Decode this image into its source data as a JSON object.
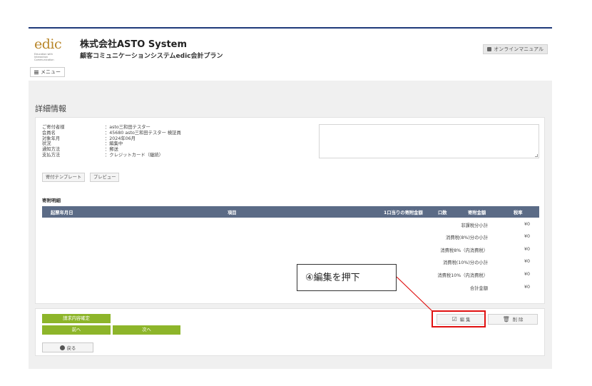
{
  "header": {
    "logo_word": "edic",
    "logo_tagline": "Education with Interaction Communication",
    "company": "株式会社ASTO System",
    "plan": "顧客コミュニケーションシステムedic会計プラン",
    "manual_label": "オンラインマニュアル",
    "menu_label": "メニュー"
  },
  "page": {
    "title": "詳細情報"
  },
  "info": {
    "rows": [
      {
        "label": "ご寄付者様",
        "value": "：asto三和田テスター"
      },
      {
        "label": "会員名",
        "value": "：45680 asto三和田テスター 検証員"
      },
      {
        "label": "対象年月",
        "value": "：2024年06月"
      },
      {
        "label": "状況",
        "value": "：編集中"
      },
      {
        "label": "通知方法",
        "value": "：郵送"
      },
      {
        "label": "支払方法",
        "value": "：クレジットカード（継続）"
      }
    ]
  },
  "buttons": {
    "template": "寄付テンプレート",
    "preview": "プレビュー",
    "confirm": "請求内容確定",
    "prev": "前へ",
    "next": "次へ",
    "back": "戻る",
    "edit": "編 集",
    "delete": "削 除"
  },
  "details": {
    "section_label": "寄附明細",
    "columns": [
      "起票年月日",
      "項目",
      "1口当りの寄附金額",
      "口数",
      "寄附金額",
      "税率"
    ],
    "summary": [
      {
        "label": "非課税分小計",
        "value": "¥0"
      },
      {
        "label": "消費税(8%)分の小計",
        "value": "¥0"
      },
      {
        "label": "消費税8%（内消費税）",
        "value": "¥0"
      },
      {
        "label": "消費税(10%)分の小計",
        "value": "¥0"
      },
      {
        "label": "消費税10%（内消費税）",
        "value": "¥0"
      },
      {
        "label": "合計金額",
        "value": "¥0"
      }
    ]
  },
  "annotation": {
    "text": "④編集を押下",
    "color": "#e01010"
  }
}
